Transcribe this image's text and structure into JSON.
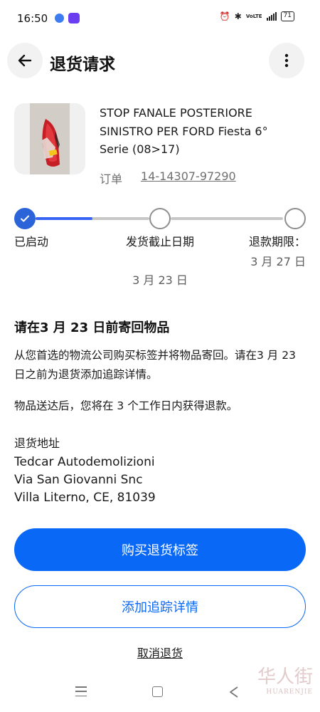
{
  "status_bar": {
    "time": "16:50",
    "battery": "71",
    "network": "VoLTE"
  },
  "header": {
    "title": "退货请求"
  },
  "item": {
    "title": "STOP FANALE POSTERIORE SINISTRO PER FORD Fiesta 6° Serie (08>17)",
    "order_label": "订单",
    "order_number": "14-14307-97290"
  },
  "progress": {
    "fraction_of_first_segment": 0.5,
    "steps": [
      {
        "label": "已启动",
        "date": "",
        "state": "done"
      },
      {
        "label": "发货截止日期",
        "date": "3 月 23 日",
        "state": "pending"
      },
      {
        "label": "退款期限：",
        "date": "3 月 27 日",
        "state": "pending"
      }
    ]
  },
  "instructions": {
    "heading": "请在3 月 23 日前寄回物品",
    "para1": "从您首选的物流公司购买标签并将物品寄回。请在3 月 23 日之前为退货添加追踪详情。",
    "para2": "物品送达后，您将在 3 个工作日内获得退款。"
  },
  "address": {
    "label": "退货地址",
    "lines": [
      "Tedcar Autodemolizioni",
      "Via San Giovanni Snc",
      "Villa Literno, CE, 81039"
    ]
  },
  "actions": {
    "buy_label": "购买退货标签",
    "tracking_label": "添加追踪详情",
    "cancel_label": "取消退货"
  },
  "colors": {
    "primary": "#0968f6",
    "progress": "#3665f3"
  },
  "icons": [
    "back-arrow-icon",
    "more-vert-icon",
    "checkmark-icon",
    "nav-menu-icon",
    "nav-home-icon",
    "nav-back-icon"
  ],
  "watermark": {
    "text": "华人街",
    "subtext": "HUARENJIE"
  }
}
